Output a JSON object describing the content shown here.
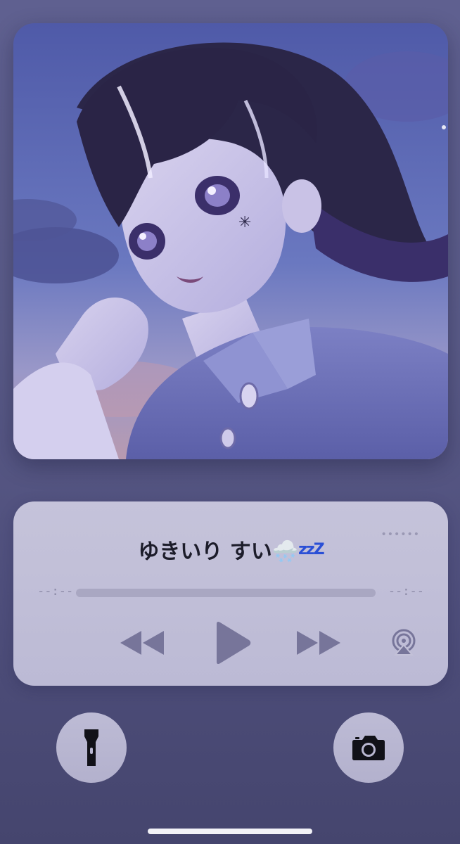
{
  "now_playing": {
    "title": "ゆきいり すい🌨️",
    "title_suffix": "zzZ",
    "elapsed": "--:--",
    "remaining": "--:--",
    "progress": 0,
    "more_label": "••••••"
  },
  "controls": {
    "rewind_icon": "rewind-icon",
    "play_icon": "play-icon",
    "forward_icon": "fast-forward-icon",
    "airplay_icon": "airplay-icon"
  },
  "quick_actions": {
    "left_icon": "flashlight-icon",
    "right_icon": "camera-icon"
  },
  "colors": {
    "background": "#5a5b88",
    "card": "#c3c1d8",
    "control": "#77759a",
    "title": "#1c1c2a",
    "zzz": "#2a4fd6"
  }
}
